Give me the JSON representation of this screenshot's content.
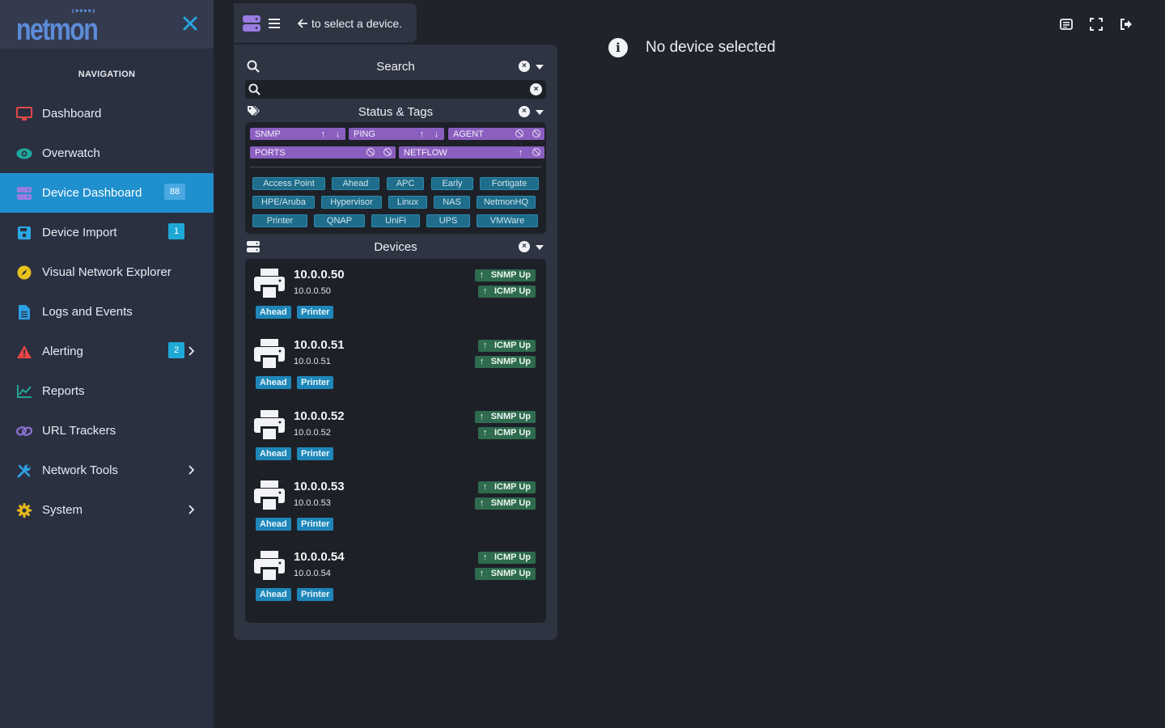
{
  "brand": {
    "name": "netmon",
    "dots": "‹••••›"
  },
  "nav": {
    "heading": "NAVIGATION",
    "items": [
      {
        "label": "Dashboard",
        "icon": "monitor-icon"
      },
      {
        "label": "Overwatch",
        "icon": "eye-icon"
      },
      {
        "label": "Device Dashboard",
        "icon": "server-icon",
        "badge": "88",
        "active": true
      },
      {
        "label": "Device Import",
        "icon": "floppy-icon",
        "badge": "1"
      },
      {
        "label": "Visual Network Explorer",
        "icon": "compass-icon"
      },
      {
        "label": "Logs and Events",
        "icon": "file-text-icon"
      },
      {
        "label": "Alerting",
        "icon": "warning-icon",
        "badge": "2"
      },
      {
        "label": "Reports",
        "icon": "line-chart-icon"
      },
      {
        "label": "URL Trackers",
        "icon": "link-icon"
      },
      {
        "label": "Network Tools",
        "icon": "tools-icon"
      },
      {
        "label": "System",
        "icon": "gear-icon"
      }
    ]
  },
  "topbar": {
    "hint": "to select a device."
  },
  "main": {
    "no_device": "No device selected",
    "info_glyph": "i"
  },
  "filters": {
    "search": {
      "title": "Search",
      "value": "",
      "placeholder": ""
    },
    "status_tags": {
      "title": "Status & Tags",
      "statuses": [
        "SNMP",
        "PING",
        "AGENT",
        "PORTS",
        "NETFLOW"
      ],
      "tags": [
        "Access Point",
        "Ahead",
        "APC",
        "Early",
        "Fortigate",
        "HPE/Aruba",
        "Hypervisor",
        "Linux",
        "NAS",
        "NetmonHQ",
        "Printer",
        "QNAP",
        "UniFi",
        "UPS",
        "VMWare"
      ]
    },
    "devices_title": "Devices"
  },
  "devices": [
    {
      "name": "10.0.0.50",
      "ip": "10.0.0.50",
      "tags": [
        "Ahead",
        "Printer"
      ],
      "status": [
        "SNMP Up",
        "ICMP Up"
      ]
    },
    {
      "name": "10.0.0.51",
      "ip": "10.0.0.51",
      "tags": [
        "Ahead",
        "Printer"
      ],
      "status": [
        "ICMP Up",
        "SNMP Up"
      ]
    },
    {
      "name": "10.0.0.52",
      "ip": "10.0.0.52",
      "tags": [
        "Ahead",
        "Printer"
      ],
      "status": [
        "SNMP Up",
        "ICMP Up"
      ]
    },
    {
      "name": "10.0.0.53",
      "ip": "10.0.0.53",
      "tags": [
        "Ahead",
        "Printer"
      ],
      "status": [
        "ICMP Up",
        "SNMP Up"
      ]
    },
    {
      "name": "10.0.0.54",
      "ip": "10.0.0.54",
      "tags": [
        "Ahead",
        "Printer"
      ],
      "status": [
        "ICMP Up",
        "SNMP Up"
      ]
    }
  ],
  "colors": {
    "accent": "#1f8fce",
    "status_purple": "#8a5fbf",
    "tag_teal": "#1e6d8a",
    "up_green": "#2f6b4e"
  }
}
